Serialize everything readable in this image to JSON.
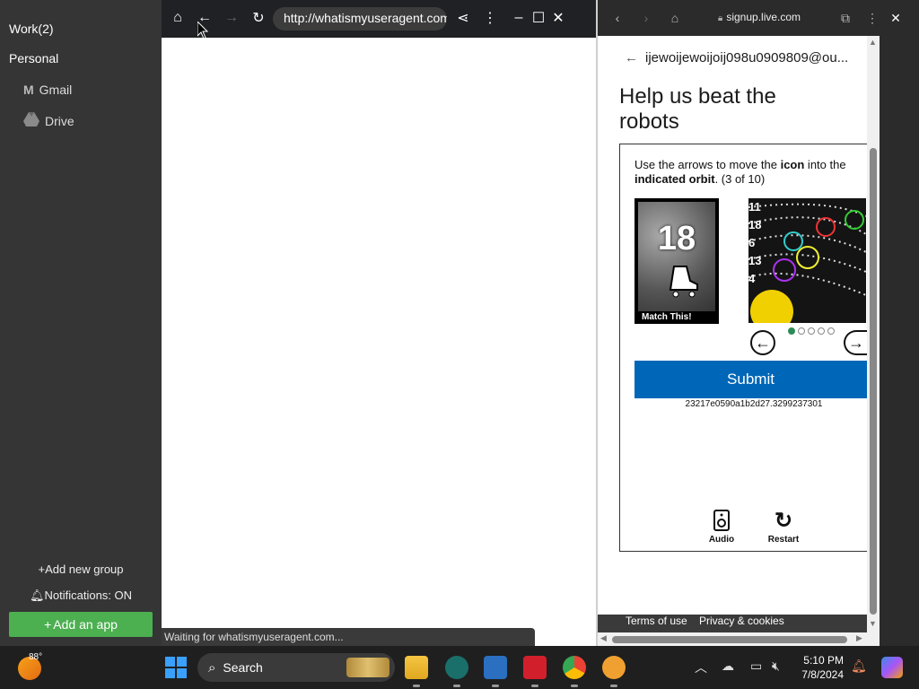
{
  "sidebar": {
    "groups": [
      {
        "label": "Work(2)"
      },
      {
        "label": "Personal"
      }
    ],
    "apps": [
      {
        "label": "Gmail",
        "icon": "gmail-icon"
      },
      {
        "label": "Drive",
        "icon": "drive-icon"
      }
    ],
    "add_group": "Add new group",
    "notifications": "Notifications: ON",
    "add_app": "Add an app"
  },
  "browser_left": {
    "url": "http://whatismyuseragent.com",
    "status": "Waiting for whatismyuseragent.com..."
  },
  "browser_right": {
    "url": "signup.live.com",
    "email": "ijewoijewoijoij098u0909809@ou...",
    "heading": "Help us beat the robots",
    "instruction": {
      "part1": "Use the arrows to move the ",
      "bold1": "icon",
      "part2": " into the ",
      "bold2": "indicated orbit",
      "part3": ". (3 of 10)"
    },
    "match_number": "18",
    "match_label": "Match This!",
    "orbit_labels": [
      "11",
      "18",
      "6",
      "13",
      "4"
    ],
    "submit": "Submit",
    "token": "23217e0590a1b2d27.3299237301",
    "audio": "Audio",
    "restart": "Restart",
    "footer_terms": "Terms of use",
    "footer_privacy": "Privacy & cookies"
  },
  "taskbar": {
    "temp": "88°",
    "search": "Search",
    "time": "5:10 PM",
    "date": "7/8/2024"
  },
  "colors": {
    "submit_blue": "#0067b8",
    "add_app_green": "#4caf50"
  }
}
